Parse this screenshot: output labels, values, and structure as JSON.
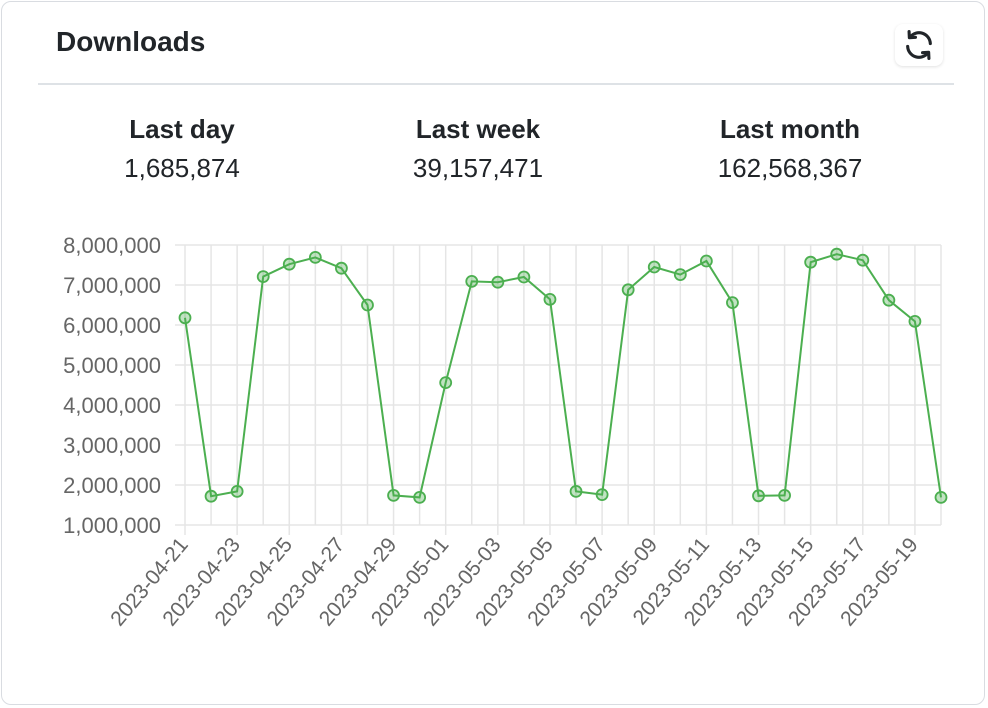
{
  "card": {
    "title": "Downloads",
    "refresh_icon": "refresh-icon"
  },
  "stats": [
    {
      "label": "Last day",
      "value": "1,685,874"
    },
    {
      "label": "Last week",
      "value": "39,157,471"
    },
    {
      "label": "Last month",
      "value": "162,568,367"
    }
  ],
  "colors": {
    "line": "#4caf50",
    "point_fill": "rgba(76,175,80,0.35)",
    "grid": "#e5e5e5"
  },
  "chart_data": {
    "type": "line",
    "title": "",
    "xlabel": "",
    "ylabel": "",
    "grid": true,
    "ylim": [
      1000000,
      8000000
    ],
    "yticks": [
      1000000,
      2000000,
      3000000,
      4000000,
      5000000,
      6000000,
      7000000,
      8000000
    ],
    "ytick_labels": [
      "1,000,000",
      "2,000,000",
      "3,000,000",
      "4,000,000",
      "5,000,000",
      "6,000,000",
      "7,000,000",
      "8,000,000"
    ],
    "xtick_labels": [
      "2023-04-21",
      "2023-04-23",
      "2023-04-25",
      "2023-04-27",
      "2023-04-29",
      "2023-05-01",
      "2023-05-03",
      "2023-05-05",
      "2023-05-07",
      "2023-05-09",
      "2023-05-11",
      "2023-05-13",
      "2023-05-15",
      "2023-05-17",
      "2023-05-19"
    ],
    "x": [
      "2023-04-21",
      "2023-04-22",
      "2023-04-23",
      "2023-04-24",
      "2023-04-25",
      "2023-04-26",
      "2023-04-27",
      "2023-04-28",
      "2023-04-29",
      "2023-04-30",
      "2023-05-01",
      "2023-05-02",
      "2023-05-03",
      "2023-05-04",
      "2023-05-05",
      "2023-05-06",
      "2023-05-07",
      "2023-05-08",
      "2023-05-09",
      "2023-05-10",
      "2023-05-11",
      "2023-05-12",
      "2023-05-13",
      "2023-05-14",
      "2023-05-15",
      "2023-05-16",
      "2023-05-17",
      "2023-05-18",
      "2023-05-19",
      "2023-05-20"
    ],
    "series": [
      {
        "values": [
          6180000,
          1720000,
          1840000,
          7210000,
          7520000,
          7690000,
          7420000,
          6500000,
          1740000,
          1690000,
          4560000,
          7090000,
          7070000,
          7200000,
          6640000,
          1840000,
          1760000,
          6880000,
          7450000,
          7260000,
          7600000,
          6560000,
          1730000,
          1740000,
          7570000,
          7770000,
          7620000,
          6620000,
          6090000,
          1690000
        ]
      }
    ]
  }
}
